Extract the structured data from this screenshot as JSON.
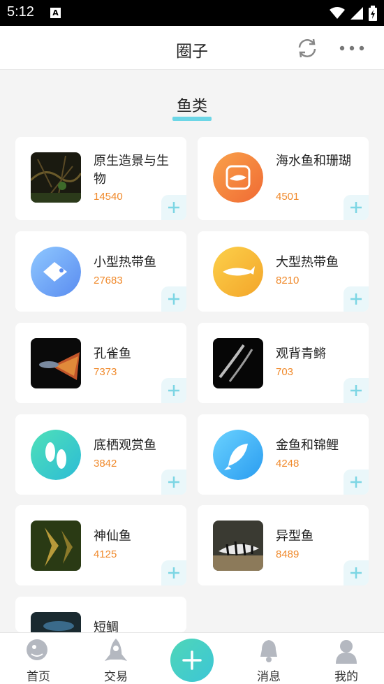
{
  "status_bar": {
    "time": "5:12",
    "notification_letter": "A"
  },
  "header": {
    "title": "圈子"
  },
  "section": {
    "title": "鱼类"
  },
  "categories": [
    {
      "name": "原生造景与生物",
      "count": "14540"
    },
    {
      "name": "海水鱼和珊瑚",
      "count": "4501"
    },
    {
      "name": "小型热带鱼",
      "count": "27683"
    },
    {
      "name": "大型热带鱼",
      "count": "8210"
    },
    {
      "name": "孔雀鱼",
      "count": "7373"
    },
    {
      "name": "观背青鳉",
      "count": "703"
    },
    {
      "name": "底栖观赏鱼",
      "count": "3842"
    },
    {
      "name": "金鱼和锦鲤",
      "count": "4248"
    },
    {
      "name": "神仙鱼",
      "count": "4125"
    },
    {
      "name": "异型鱼",
      "count": "8489"
    },
    {
      "name": "短鲷",
      "count": ""
    }
  ],
  "tabbar": {
    "home": "首页",
    "trade": "交易",
    "messages": "消息",
    "mine": "我的"
  },
  "colors": {
    "accent": "#6cd6e6",
    "count": "#f08a2c",
    "fab": "#3cc6d6"
  }
}
